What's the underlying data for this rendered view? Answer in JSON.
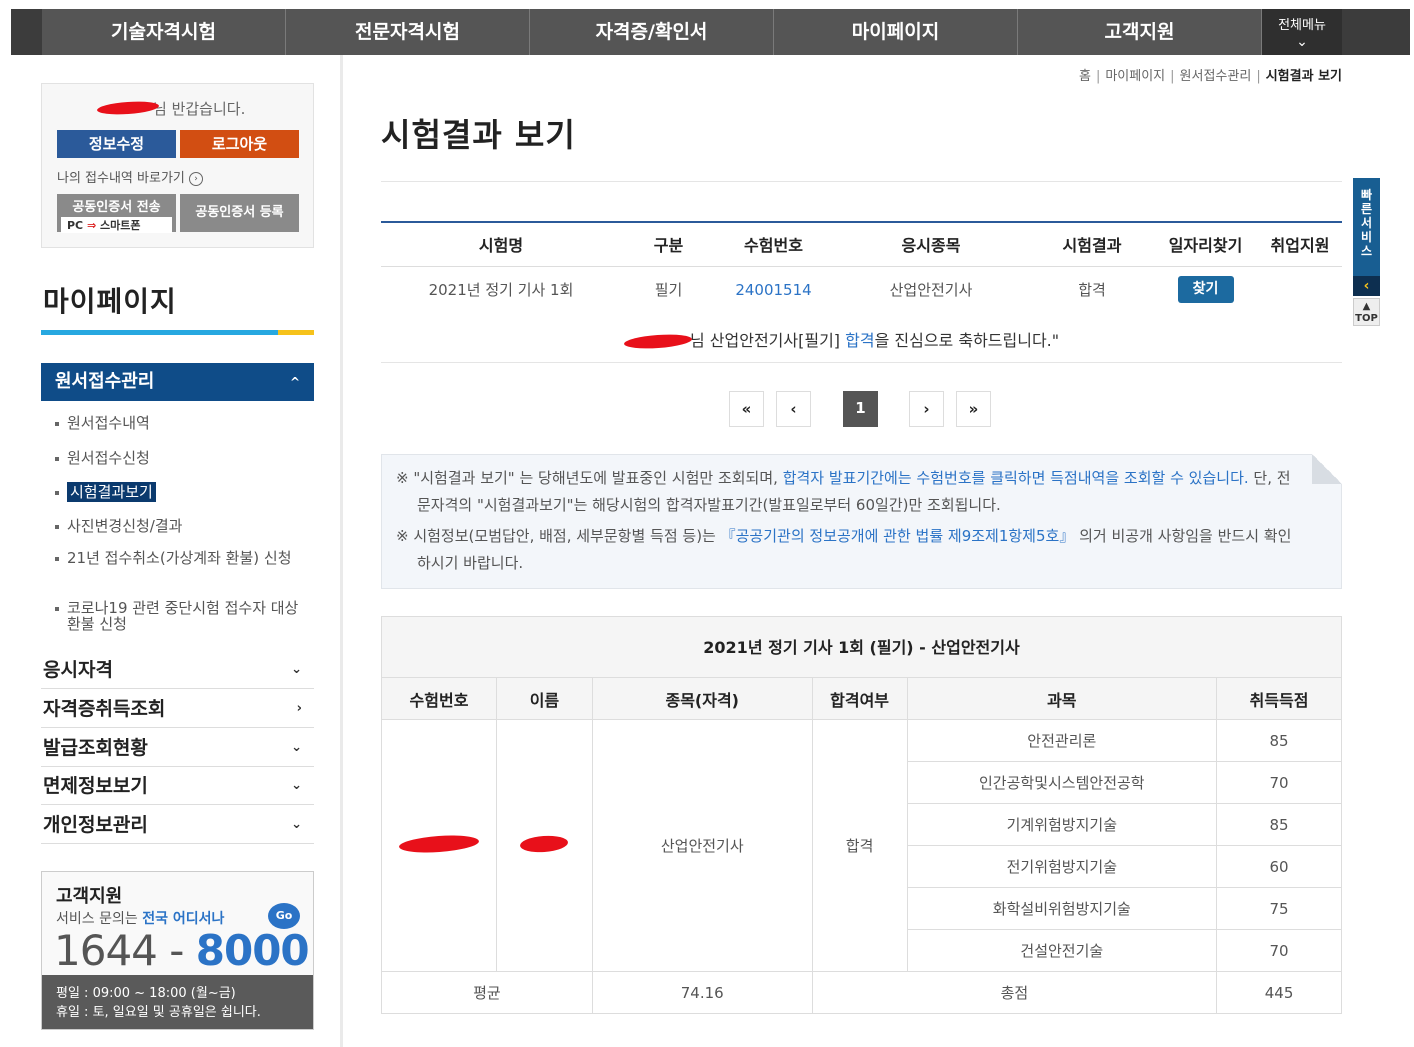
{
  "nav": {
    "items": [
      "기술자격시험",
      "전문자격시험",
      "자격증/확인서",
      "마이페이지",
      "고객지원"
    ],
    "allmenu_label": "전체메뉴",
    "allmenu_icon": "chevron-down-icon"
  },
  "user": {
    "greeting": "님 반갑습니다.",
    "edit_label": "정보수정",
    "logout_label": "로그아웃",
    "shortcut_label": "나의 접수내역 바로가기",
    "cert_send_label": "공동인증서 전송",
    "cert_send_sub_pc": "PC",
    "cert_send_sub_phone": "스마트폰",
    "cert_reg_label": "공동인증서 등록"
  },
  "sidebar": {
    "title": "마이페이지",
    "section": "원서접수관리",
    "subitems": [
      "원서접수내역",
      "원서접수신청",
      "시험결과보기",
      "사진변경신청/결과",
      "21년 접수취소(가상계좌 환불) 신청",
      "코로나19 관련 중단시험 접수자 대상 환불 신청"
    ],
    "menus": [
      "응시자격",
      "자격증취득조회",
      "발급조회현황",
      "면제정보보기",
      "개인정보관리"
    ]
  },
  "cs": {
    "title": "고객지원",
    "sub_prefix": "서비스 문의는 ",
    "sub_highlight": "전국 어디서나",
    "go": "Go",
    "num_a": "1644",
    "num_dash": " - ",
    "num_b": "8000",
    "hours_weekday": "평일 : 09:00 ~ 18:00 (월~금)",
    "hours_holiday": "휴일 : 토, 일요일 및 공휴일은 쉽니다."
  },
  "breadcrumb": [
    "홈",
    "마이페이지",
    "원서접수관리",
    "시험결과 보기"
  ],
  "page_title": "시험결과 보기",
  "result_table": {
    "headers": [
      "시험명",
      "구분",
      "수험번호",
      "응시종목",
      "시험결과",
      "일자리찾기",
      "취업지원"
    ],
    "row": {
      "exam": "2021년 정기 기사 1회",
      "type": "필기",
      "number": "24001514",
      "subject": "산업안전기사",
      "result": "합격",
      "find_label": "찾기"
    }
  },
  "congrats": {
    "prefix": "님 산업안전기사[필기] ",
    "pass": "합격",
    "suffix": "을 진심으로 축하드립니다.\""
  },
  "pagination": {
    "first": "«",
    "prev": "‹",
    "current": "1",
    "next": "›",
    "last": "»"
  },
  "notice": {
    "line1_a": "※ \"시험결과 보기\" 는 당해년도에 발표중인 시험만 조회되며, ",
    "line1_blue": "합격자 발표기간에는 수험번호를 클릭하면 득점내역을 조회할 수 있습니다.",
    "line1_b": " 단, 전문자격의 \"시험결과보기\"는 해당시험의 합격자발표기간(발표일로부터 60일간)만 조회됩니다.",
    "line2_a": "※ 시험정보(모범답안, 배점, 세부문항별 득점 등)는 ",
    "line2_blue": "『공공기관의 정보공개에 관한 법률 제9조제1항제5호』",
    "line2_b": " 의거 비공개 사항임을 반드시 확인하시기 바랍니다."
  },
  "detail": {
    "title": "2021년 정기 기사 1회 (필기) - 산업안전기사",
    "headers": [
      "수험번호",
      "이름",
      "종목(자격)",
      "합격여부",
      "과목",
      "취득득점"
    ],
    "subject": "산업안전기사",
    "result": "합격",
    "rows": [
      {
        "name": "안전관리론",
        "score": "85"
      },
      {
        "name": "인간공학및시스템안전공학",
        "score": "70"
      },
      {
        "name": "기계위험방지기술",
        "score": "85"
      },
      {
        "name": "전기위험방지기술",
        "score": "60"
      },
      {
        "name": "화학설비위험방지기술",
        "score": "75"
      },
      {
        "name": "건설안전기술",
        "score": "70"
      }
    ],
    "avg_label": "평균",
    "avg_value": "74.16",
    "total_label": "총점",
    "total_value": "445"
  },
  "quick": {
    "label": "빠른서비스",
    "top": "TOP"
  },
  "colors": {
    "nav": "#555555",
    "primary": "#0f4c88",
    "accent": "#2b73c6",
    "logout": "#d24e12"
  }
}
